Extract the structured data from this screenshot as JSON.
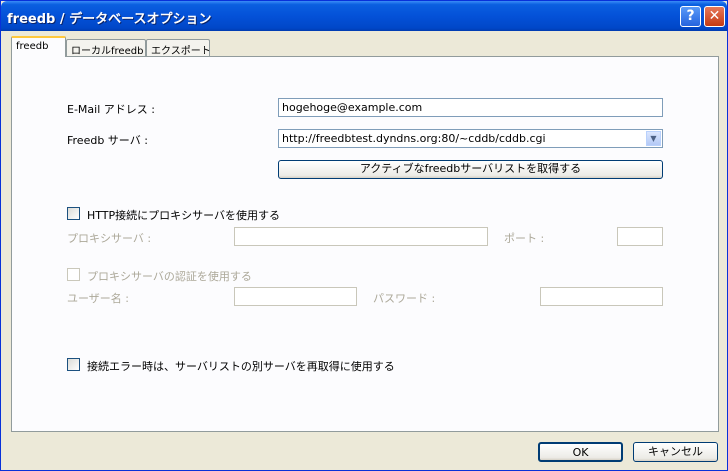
{
  "window": {
    "title": "freedb / データベースオプション",
    "help_glyph": "?",
    "close_glyph": "✕"
  },
  "tabs": [
    {
      "label": "freedb",
      "active": true
    },
    {
      "label": "ローカルfreedb",
      "active": false
    },
    {
      "label": "エクスポート",
      "active": false
    }
  ],
  "form": {
    "email_label": "E-Mail アドレス :",
    "email_value": "hogehoge@example.com",
    "server_label": "Freedb サーバ :",
    "server_value": "http://freedbtest.dyndns.org:80/~cddb/cddb.cgi",
    "server_dropdown_glyph": "▼",
    "fetch_button": "アクティブなfreedbサーバリストを取得する",
    "proxy_checkbox_label": "HTTP接続にプロキシサーバを使用する",
    "proxy_checked": false,
    "proxy_server_label": "プロキシサーバ :",
    "proxy_server_value": "",
    "port_label": "ポート :",
    "port_value": "",
    "proxy_auth_label": "プロキシサーバの認証を使用する",
    "proxy_auth_checked": false,
    "username_label": "ユーザー名 :",
    "username_value": "",
    "password_label": "パスワード :",
    "password_value": "",
    "retry_checkbox_label": "接続エラー時は、サーバリストの別サーバを再取得に使用する",
    "retry_checked": false
  },
  "buttons": {
    "ok": "OK",
    "cancel": "キャンセル"
  },
  "colors": {
    "titlebar": "#0451d8",
    "dialog_bg": "#ece9d8",
    "active_tab_accent": "#ffc83c",
    "input_border": "#7f9db9"
  }
}
